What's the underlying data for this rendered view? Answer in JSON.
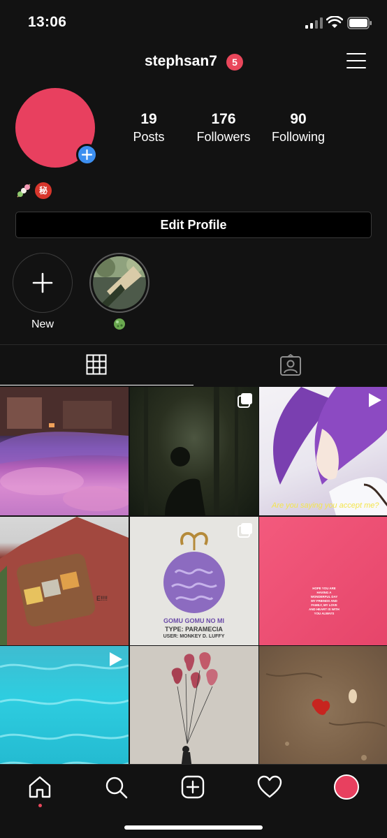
{
  "status_bar": {
    "time": "13:06"
  },
  "header": {
    "username": "stephsan7",
    "notification_count": "5"
  },
  "profile": {
    "avatar_color": "#e8405f",
    "stats": {
      "posts": {
        "value": "19",
        "label": "Posts"
      },
      "followers": {
        "value": "176",
        "label": "Followers"
      },
      "following": {
        "value": "90",
        "label": "Following"
      }
    },
    "bio_emojis": [
      "dango-icon",
      "secret-ideograph-icon"
    ],
    "bio_secret_glyph": "秘",
    "edit_button_label": "Edit Profile"
  },
  "highlights": [
    {
      "label": "New",
      "icon": "plus-icon"
    },
    {
      "label": "",
      "icon": "green-ball-emoji"
    }
  ],
  "tabs": [
    {
      "name": "grid",
      "icon": "grid-icon",
      "active": true
    },
    {
      "name": "tagged",
      "icon": "tagged-person-icon",
      "active": false
    }
  ],
  "posts": [
    {
      "description": "sunset-reflection",
      "type": "photo"
    },
    {
      "description": "forest-silhouette",
      "type": "carousel"
    },
    {
      "description": "anime-purple-hair",
      "type": "video",
      "caption": "Are you saying you accept me?"
    },
    {
      "description": "fist-mural",
      "type": "photo"
    },
    {
      "description": "gomu-gomu-fruit",
      "type": "carousel",
      "text": {
        "title": "GOMU GOMU NO MI",
        "type": "TYPE:   PARAMECIA",
        "user": "USER: MONKEY D. LUFFY"
      }
    },
    {
      "description": "pink-quote",
      "type": "photo",
      "text": "HOPE YOU ARE HAVING A WONDERFUL DAY MY FRIENDS AND FAMILY, MY LOVE AND HEART IS WITH YOU ALWAYS"
    },
    {
      "description": "turquoise-water",
      "type": "video"
    },
    {
      "description": "balloon-girl",
      "type": "photo"
    },
    {
      "description": "red-leaf-on-dirt",
      "type": "photo"
    }
  ],
  "bottom_nav": {
    "items": [
      "home-icon",
      "search-icon",
      "new-post-icon",
      "activity-heart-icon",
      "profile-avatar"
    ],
    "accent": "#e9475b"
  }
}
